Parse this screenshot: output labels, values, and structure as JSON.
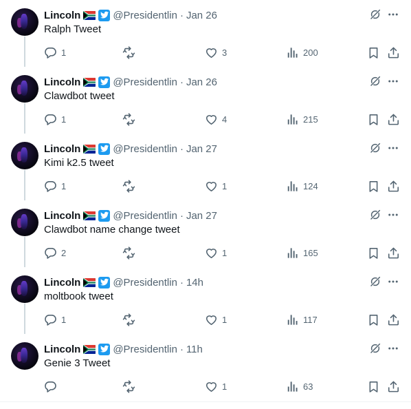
{
  "author": {
    "name": "Lincoln",
    "handle": "@Presidentlin",
    "flag_icon": "south-africa-flag-icon",
    "verified_icon": "twitter-bird-badge-icon"
  },
  "colors": {
    "text_primary": "#0f1419",
    "text_secondary": "#536471",
    "accent": "#1d9bf0",
    "thread_line": "#cfd9de"
  },
  "separator": "·",
  "tweets": [
    {
      "text": "Ralph Tweet",
      "time": "Jan 26",
      "replies": "1",
      "retweets": "",
      "likes": "3",
      "views": "200"
    },
    {
      "text": "Clawdbot tweet",
      "time": "Jan 26",
      "replies": "1",
      "retweets": "",
      "likes": "4",
      "views": "215"
    },
    {
      "text": "Kimi k2.5 tweet",
      "time": "Jan 27",
      "replies": "1",
      "retweets": "",
      "likes": "1",
      "views": "124"
    },
    {
      "text": "Clawdbot name change tweet",
      "time": "Jan 27",
      "replies": "2",
      "retweets": "",
      "likes": "1",
      "views": "165"
    },
    {
      "text": "moltbook tweet",
      "time": "14h",
      "replies": "1",
      "retweets": "",
      "likes": "1",
      "views": "117"
    },
    {
      "text": "Genie 3 Tweet",
      "time": "11h",
      "replies": "",
      "retweets": "",
      "likes": "1",
      "views": "63"
    }
  ]
}
